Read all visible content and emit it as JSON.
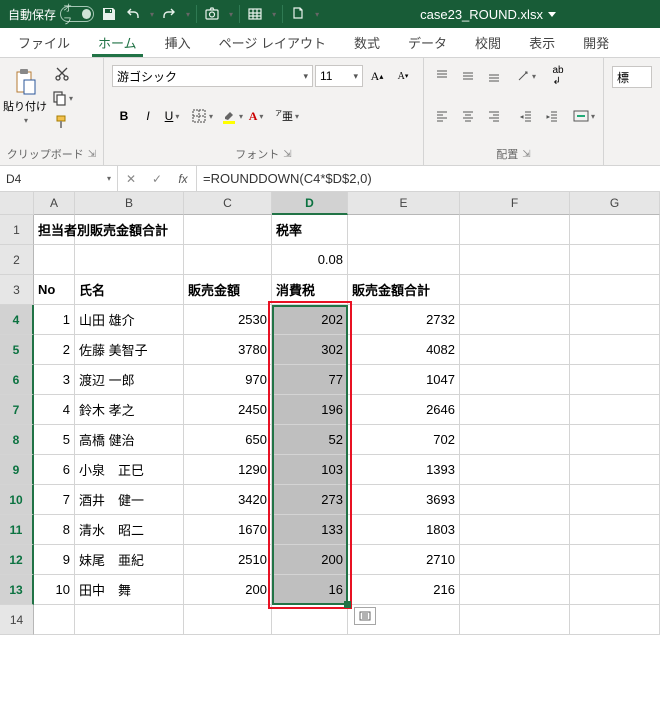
{
  "titlebar": {
    "autosave_label": "自動保存",
    "autosave_state": "オフ",
    "filename": "case23_ROUND.xlsx"
  },
  "tabs": {
    "file": "ファイル",
    "home": "ホーム",
    "insert": "挿入",
    "pagelayout": "ページ レイアウト",
    "formulas": "数式",
    "data": "データ",
    "review": "校閲",
    "view": "表示",
    "dev": "開発"
  },
  "ribbon": {
    "paste": "貼り付け",
    "clipboard": "クリップボード",
    "font_name": "游ゴシック",
    "font_size": "11",
    "font_group": "フォント",
    "align_group": "配置"
  },
  "namebox": "D4",
  "formula": "=ROUNDDOWN(C4*$D$2,0)",
  "cols": {
    "A": "A",
    "B": "B",
    "C": "C",
    "D": "D",
    "E": "E",
    "F": "F",
    "G": "G"
  },
  "rowlabels": [
    "1",
    "2",
    "3",
    "4",
    "5",
    "6",
    "7",
    "8",
    "9",
    "10",
    "11",
    "12",
    "13",
    "14"
  ],
  "hdr1_title": "担当者別販売金額合計",
  "hdr1_rate": "税率",
  "rate_value": "0.08",
  "hdr3": {
    "no": "No",
    "name": "氏名",
    "sales": "販売金額",
    "tax": "消費税",
    "total": "販売金額合計"
  },
  "rows": [
    {
      "no": "1",
      "name": "山田 雄介",
      "sales": "2530",
      "tax": "202",
      "total": "2732"
    },
    {
      "no": "2",
      "name": "佐藤 美智子",
      "sales": "3780",
      "tax": "302",
      "total": "4082"
    },
    {
      "no": "3",
      "name": "渡辺 一郎",
      "sales": "970",
      "tax": "77",
      "total": "1047"
    },
    {
      "no": "4",
      "name": "鈴木 孝之",
      "sales": "2450",
      "tax": "196",
      "total": "2646"
    },
    {
      "no": "5",
      "name": "高橋 健治",
      "sales": "650",
      "tax": "52",
      "total": "702"
    },
    {
      "no": "6",
      "name": "小泉　正巳",
      "sales": "1290",
      "tax": "103",
      "total": "1393"
    },
    {
      "no": "7",
      "name": "酒井　健一",
      "sales": "3420",
      "tax": "273",
      "total": "3693"
    },
    {
      "no": "8",
      "name": "清水　昭二",
      "sales": "1670",
      "tax": "133",
      "total": "1803"
    },
    {
      "no": "9",
      "name": "妹尾　亜紀",
      "sales": "2510",
      "tax": "200",
      "total": "2710"
    },
    {
      "no": "10",
      "name": "田中　舞",
      "sales": "200",
      "tax": "16",
      "total": "216"
    }
  ],
  "standard_label": "標"
}
